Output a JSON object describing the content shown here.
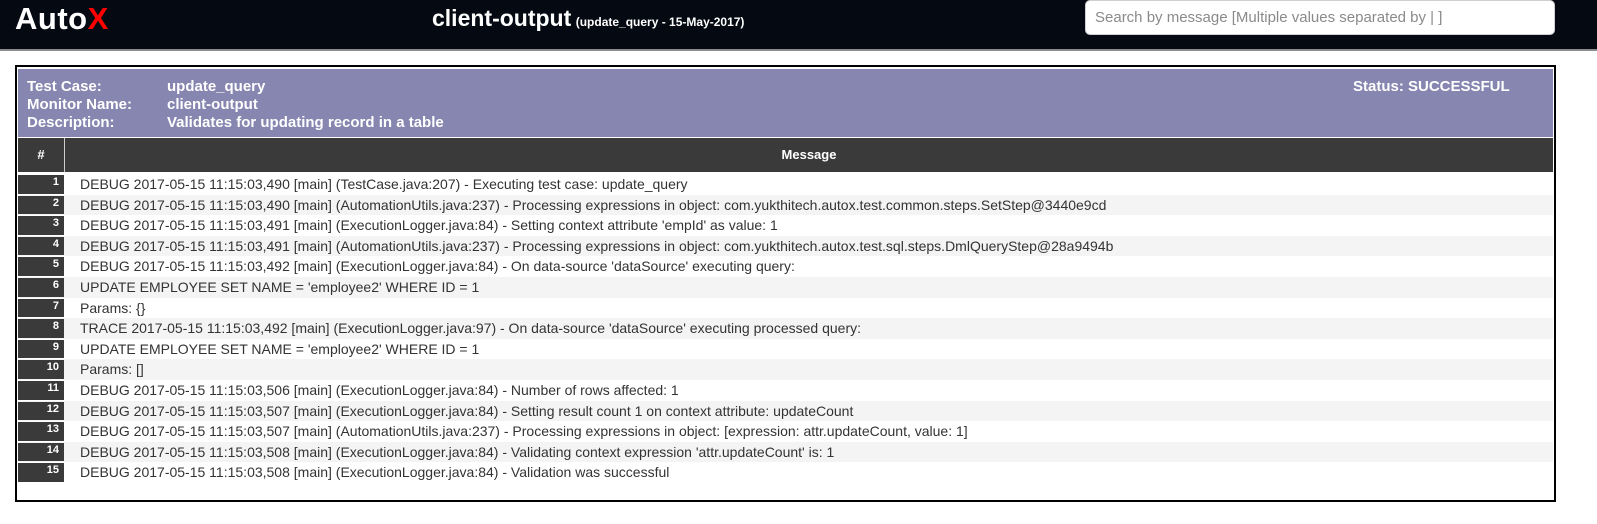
{
  "header": {
    "logo_text": "Auto",
    "logo_accent": "X",
    "title": "client-output",
    "subtitle": "(update_query - 15-May-2017)",
    "search_placeholder": "Search by message [Multiple values separated by | ]"
  },
  "test_info": {
    "test_case_label": "Test Case:",
    "test_case_value": "update_query",
    "monitor_label": "Monitor Name:",
    "monitor_value": "client-output",
    "description_label": "Description:",
    "description_value": "Validates for updating record in a table",
    "status_text": "Status: SUCCESSFUL"
  },
  "table": {
    "col_number": "#",
    "col_message": "Message",
    "rows": [
      {
        "num": "1",
        "message": "DEBUG 2017-05-15 11:15:03,490 [main] (TestCase.java:207) - Executing test case: update_query"
      },
      {
        "num": "2",
        "message": "DEBUG 2017-05-15 11:15:03,490 [main] (AutomationUtils.java:237) - Processing expressions in object: com.yukthitech.autox.test.common.steps.SetStep@3440e9cd"
      },
      {
        "num": "3",
        "message": "DEBUG 2017-05-15 11:15:03,491 [main] (ExecutionLogger.java:84) - Setting context attribute 'empId' as value: 1"
      },
      {
        "num": "4",
        "message": "DEBUG 2017-05-15 11:15:03,491 [main] (AutomationUtils.java:237) - Processing expressions in object: com.yukthitech.autox.test.sql.steps.DmlQueryStep@28a9494b"
      },
      {
        "num": "5",
        "message": "DEBUG 2017-05-15 11:15:03,492 [main] (ExecutionLogger.java:84) - On data-source 'dataSource' executing query:"
      },
      {
        "num": "6",
        "message": "UPDATE EMPLOYEE SET NAME = 'employee2' WHERE ID = 1"
      },
      {
        "num": "7",
        "message": "Params: {}"
      },
      {
        "num": "8",
        "message": "TRACE 2017-05-15 11:15:03,492 [main] (ExecutionLogger.java:97) - On data-source 'dataSource' executing processed query:"
      },
      {
        "num": "9",
        "message": "UPDATE EMPLOYEE SET NAME = 'employee2' WHERE ID = 1"
      },
      {
        "num": "10",
        "message": "Params: []"
      },
      {
        "num": "11",
        "message": "DEBUG 2017-05-15 11:15:03,506 [main] (ExecutionLogger.java:84) - Number of rows affected: 1"
      },
      {
        "num": "12",
        "message": "DEBUG 2017-05-15 11:15:03,507 [main] (ExecutionLogger.java:84) - Setting result count 1 on context attribute: updateCount"
      },
      {
        "num": "13",
        "message": "DEBUG 2017-05-15 11:15:03,507 [main] (AutomationUtils.java:237) - Processing expressions in object: [expression: attr.updateCount, value: 1]"
      },
      {
        "num": "14",
        "message": "DEBUG 2017-05-15 11:15:03,508 [main] (ExecutionLogger.java:84) - Validating context expression 'attr.updateCount' is: 1"
      },
      {
        "num": "15",
        "message": "DEBUG 2017-05-15 11:15:03,508 [main] (ExecutionLogger.java:84) - Validation was successful"
      }
    ]
  },
  "colors": {
    "topbar_bg": "#050a12",
    "logo_accent": "#ff0000",
    "info_bg": "#8686b0",
    "table_header_bg": "#3a3a3a"
  }
}
